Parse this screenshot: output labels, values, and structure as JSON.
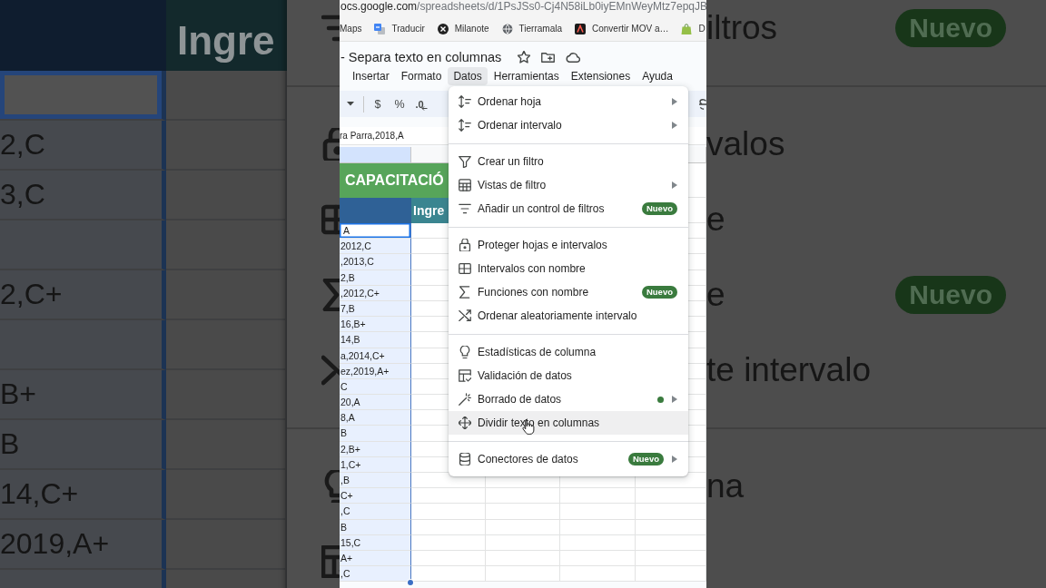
{
  "backdrop": {
    "column_header": "Ingre",
    "columns": [
      {
        "selected": true
      },
      {
        "selected": false
      }
    ],
    "rows": [
      {
        "selected": true
      },
      {
        "selected": false,
        "text": "2,C"
      },
      {
        "selected": false,
        "text": "3,C"
      },
      {
        "selected": false
      },
      {
        "selected": false,
        "text": "2,C+"
      },
      {
        "selected": false
      },
      {
        "selected": false,
        "text": "B+"
      },
      {
        "selected": false,
        "text": "B"
      },
      {
        "selected": false,
        "text": "14,C+"
      },
      {
        "selected": false,
        "text": "2019,A+"
      },
      {
        "selected": false
      }
    ],
    "menu_items": [
      {
        "kind": "item",
        "label": "iltros",
        "badge": "Nuevo"
      },
      {
        "kind": "separator"
      },
      {
        "kind": "item",
        "label": "valos"
      },
      {
        "kind": "item",
        "label": "e"
      },
      {
        "kind": "item",
        "label": "e",
        "badge": "Nuevo"
      },
      {
        "kind": "item",
        "label": "te intervalo"
      },
      {
        "kind": "separator"
      },
      {
        "kind": "item",
        "label": "na"
      },
      {
        "kind": "item"
      }
    ]
  },
  "browser": {
    "address_bar": {
      "host": "ocs.google.com",
      "path": "/spreadsheets/d/1PsJSs0-Cj4N58iLb0iyEMnWeyMtz7epqJB"
    },
    "bookmarks": [
      {
        "label": "Maps"
      },
      {
        "label": "Traducir"
      },
      {
        "label": "Milanote"
      },
      {
        "label": "Tierramala"
      },
      {
        "label": "Convertir MOV a…"
      },
      {
        "label": "D"
      }
    ]
  },
  "sheet": {
    "title": "- Separa texto en columnas",
    "menubar": [
      {
        "label": "Insertar",
        "selected": false
      },
      {
        "label": "Formato",
        "selected": false
      },
      {
        "label": "Datos",
        "selected": true
      },
      {
        "label": "Herramientas",
        "selected": false
      },
      {
        "label": "Extensiones",
        "selected": false
      },
      {
        "label": "Ayuda",
        "selected": false
      }
    ],
    "toolbar": [
      {
        "kind": "currency",
        "label": "$"
      },
      {
        "kind": "percent",
        "label": "%"
      },
      {
        "kind": "decimal",
        "label": ".0"
      }
    ],
    "formula_bar": {
      "value": "ra Parra,2018,A"
    },
    "grid": {
      "columns": [
        {
          "selected": true
        },
        {
          "selected": false
        },
        {
          "selected": false
        },
        {
          "selected": false
        },
        {
          "selected": false
        }
      ],
      "banner": "CAPACITACIÓ",
      "header_column_2": "Ingre",
      "rows": [
        {
          "text": "A",
          "selected": true
        },
        {
          "text": "2012,C",
          "selected": false
        },
        {
          "text": ",2013,C",
          "selected": false
        },
        {
          "text": "2,B",
          "selected": false
        },
        {
          "text": ",2012,C+",
          "selected": false
        },
        {
          "text": "7,B",
          "selected": false
        },
        {
          "text": "16,B+",
          "selected": false
        },
        {
          "text": "14,B",
          "selected": false
        },
        {
          "text": "a,2014,C+",
          "selected": false
        },
        {
          "text": "ez,2019,A+",
          "selected": false
        },
        {
          "text": "C",
          "selected": false
        },
        {
          "text": "20,A",
          "selected": false
        },
        {
          "text": "8,A",
          "selected": false
        },
        {
          "text": "B",
          "selected": false
        },
        {
          "text": "2,B+",
          "selected": false
        },
        {
          "text": "1,C+",
          "selected": false
        },
        {
          "text": ",B",
          "selected": false
        },
        {
          "text": "C+",
          "selected": false
        },
        {
          "text": ",C",
          "selected": false
        },
        {
          "text": "B",
          "selected": false
        },
        {
          "text": "15,C",
          "selected": false
        },
        {
          "text": "A+",
          "selected": false
        },
        {
          "text": ",C",
          "selected": false
        }
      ]
    }
  },
  "menu": {
    "items": [
      {
        "kind": "item",
        "label": "Ordenar hoja",
        "submenu": true,
        "highlighted": false,
        "dot": false
      },
      {
        "kind": "item",
        "label": "Ordenar intervalo",
        "submenu": true,
        "highlighted": false,
        "dot": false
      },
      {
        "kind": "separator"
      },
      {
        "kind": "item",
        "label": "Crear un filtro",
        "submenu": false,
        "highlighted": false,
        "dot": false
      },
      {
        "kind": "item",
        "label": "Vistas de filtro",
        "submenu": true,
        "highlighted": false,
        "dot": false
      },
      {
        "kind": "item",
        "label": "Añadir un control de filtros",
        "submenu": false,
        "highlighted": false,
        "dot": false,
        "badge": "Nuevo"
      },
      {
        "kind": "separator"
      },
      {
        "kind": "item",
        "label": "Proteger hojas e intervalos",
        "submenu": false,
        "highlighted": false,
        "dot": false
      },
      {
        "kind": "item",
        "label": "Intervalos con nombre",
        "submenu": false,
        "highlighted": false,
        "dot": false
      },
      {
        "kind": "item",
        "label": "Funciones con nombre",
        "submenu": false,
        "highlighted": false,
        "dot": false,
        "badge": "Nuevo"
      },
      {
        "kind": "item",
        "label": "Ordenar aleatoriamente intervalo",
        "submenu": false,
        "highlighted": false,
        "dot": false
      },
      {
        "kind": "separator"
      },
      {
        "kind": "item",
        "label": "Estadísticas de columna",
        "submenu": false,
        "highlighted": false,
        "dot": false
      },
      {
        "kind": "item",
        "label": "Validación de datos",
        "submenu": false,
        "highlighted": false,
        "dot": false
      },
      {
        "kind": "item",
        "label": "Borrado de datos",
        "submenu": true,
        "highlighted": false,
        "dot": true
      },
      {
        "kind": "item",
        "label": "Dividir texto en columnas",
        "submenu": false,
        "highlighted": true,
        "dot": false
      },
      {
        "kind": "separator"
      },
      {
        "kind": "item",
        "label": "Conectores de datos",
        "submenu": true,
        "highlighted": false,
        "dot": false,
        "badge": "Nuevo"
      }
    ]
  }
}
